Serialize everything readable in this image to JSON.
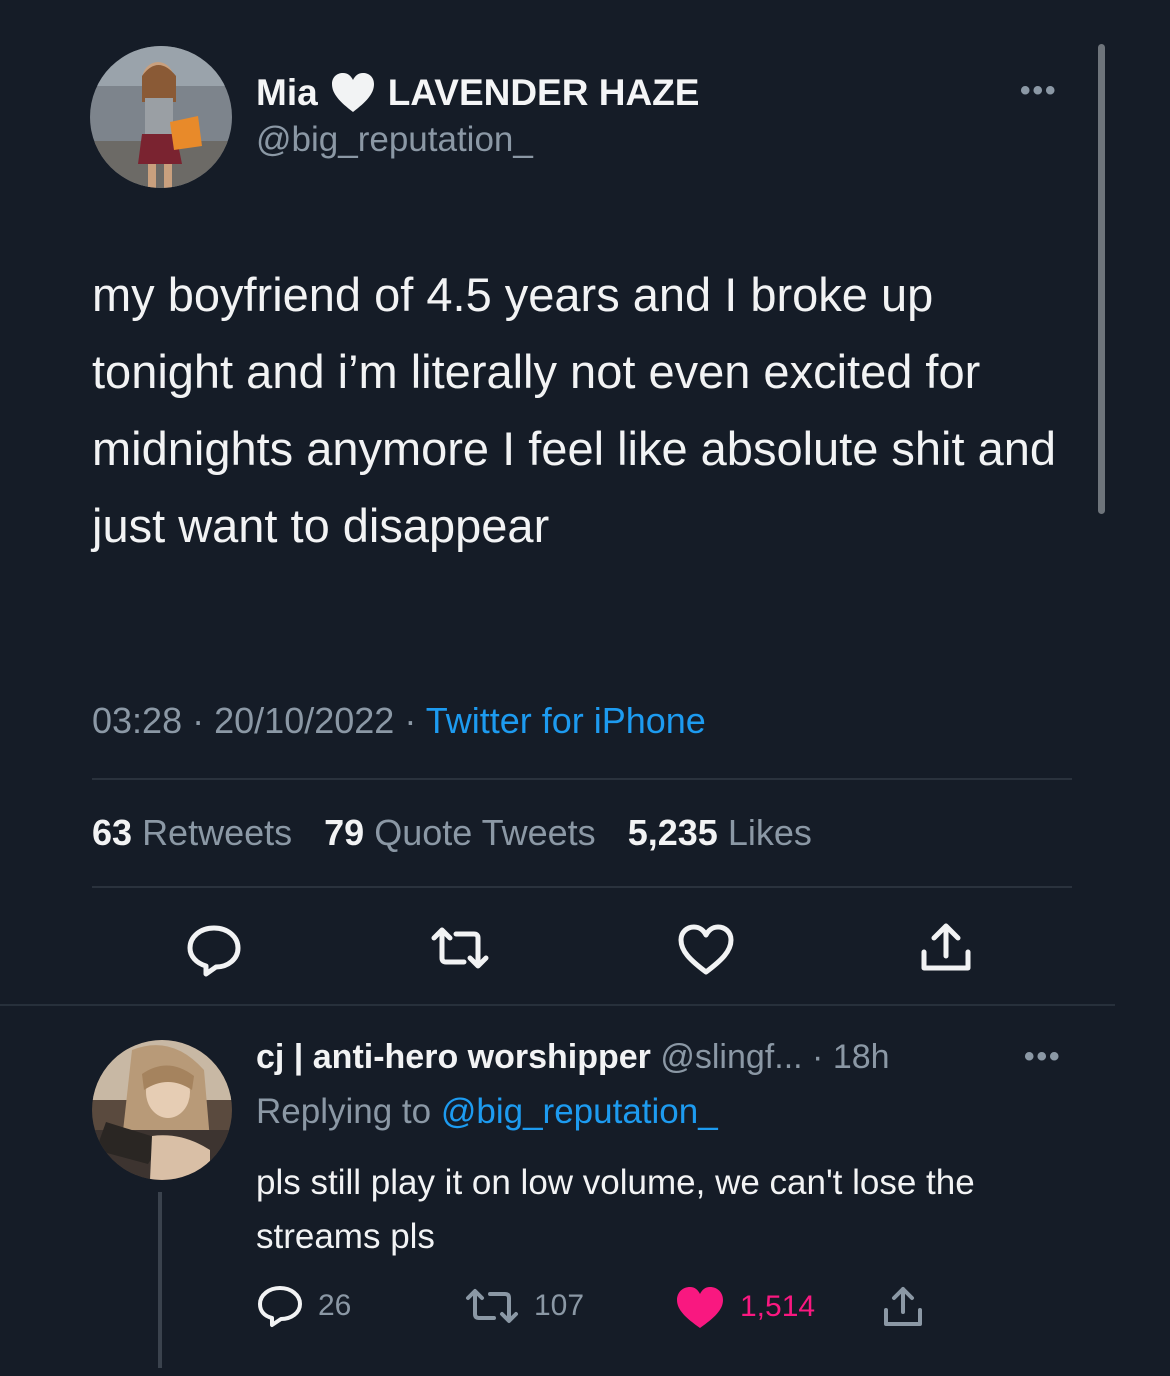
{
  "main_tweet": {
    "display_name": "Mia",
    "name_suffix": "LAVENDER HAZE",
    "handle": "@big_reputation_",
    "more_label": "•••",
    "text": "my boyfriend of 4.5 years and I broke up tonight and i’m literally not even excited for midnights anymore I feel like absolute shit and just want to disappear",
    "time": "03:28",
    "date": "20/10/2022",
    "separator": "·",
    "source": "Twitter for iPhone",
    "stats": {
      "retweets_count": "63",
      "retweets_label": "Retweets",
      "quotes_count": "79",
      "quotes_label": "Quote Tweets",
      "likes_count": "5,235",
      "likes_label": "Likes"
    },
    "icons": [
      "reply-icon",
      "retweet-icon",
      "like-icon",
      "share-icon"
    ]
  },
  "reply": {
    "display_name": "cj | anti-hero worshipper",
    "handle": "@slingf...",
    "age": "· 18h",
    "more_label": "•••",
    "replying_prefix": "Replying to",
    "replying_to": "@big_reputation_",
    "text": "pls still play it on low volume, we can't lose the streams pls",
    "replies": "26",
    "retweets": "107",
    "likes": "1,514"
  },
  "colors": {
    "background": "#151c27",
    "accent": "#1d9bf0",
    "like": "#f91880",
    "muted": "#8b98a5"
  }
}
